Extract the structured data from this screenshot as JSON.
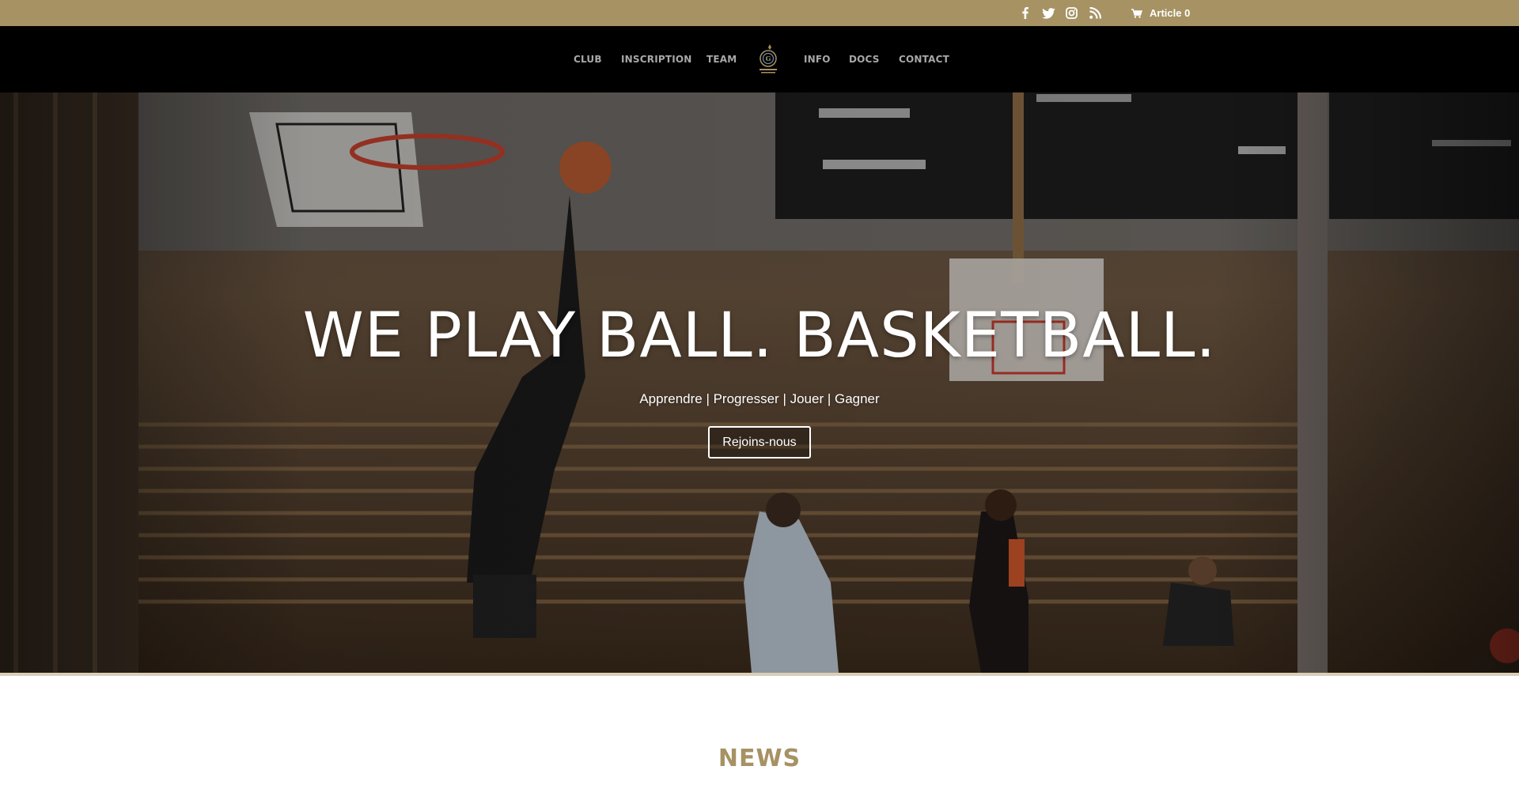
{
  "topbar": {
    "background": "#a69263",
    "social": [
      {
        "icon": "facebook-icon"
      },
      {
        "icon": "twitter-icon"
      },
      {
        "icon": "instagram-icon"
      },
      {
        "icon": "rss-icon"
      }
    ],
    "cart": {
      "icon": "cart-icon",
      "label": "Article 0"
    }
  },
  "nav": {
    "items": [
      {
        "label": "CLUB"
      },
      {
        "label": "INSCRIPTION"
      },
      {
        "label": "TEAM"
      },
      {
        "label": "INFO"
      },
      {
        "label": "DOCS"
      },
      {
        "label": "CONTACT"
      }
    ],
    "logo": "club-logo"
  },
  "hero": {
    "title": "WE PLAY BALL. BASKETBALL.",
    "subtitle": "Apprendre | Progresser | Jouer | Gagner",
    "button_label": "Rejoins-nous"
  },
  "news": {
    "title": "NEWS"
  },
  "colors": {
    "accent": "#a69263",
    "nav_background": "#000000",
    "nav_text": "#a8a8a8"
  }
}
